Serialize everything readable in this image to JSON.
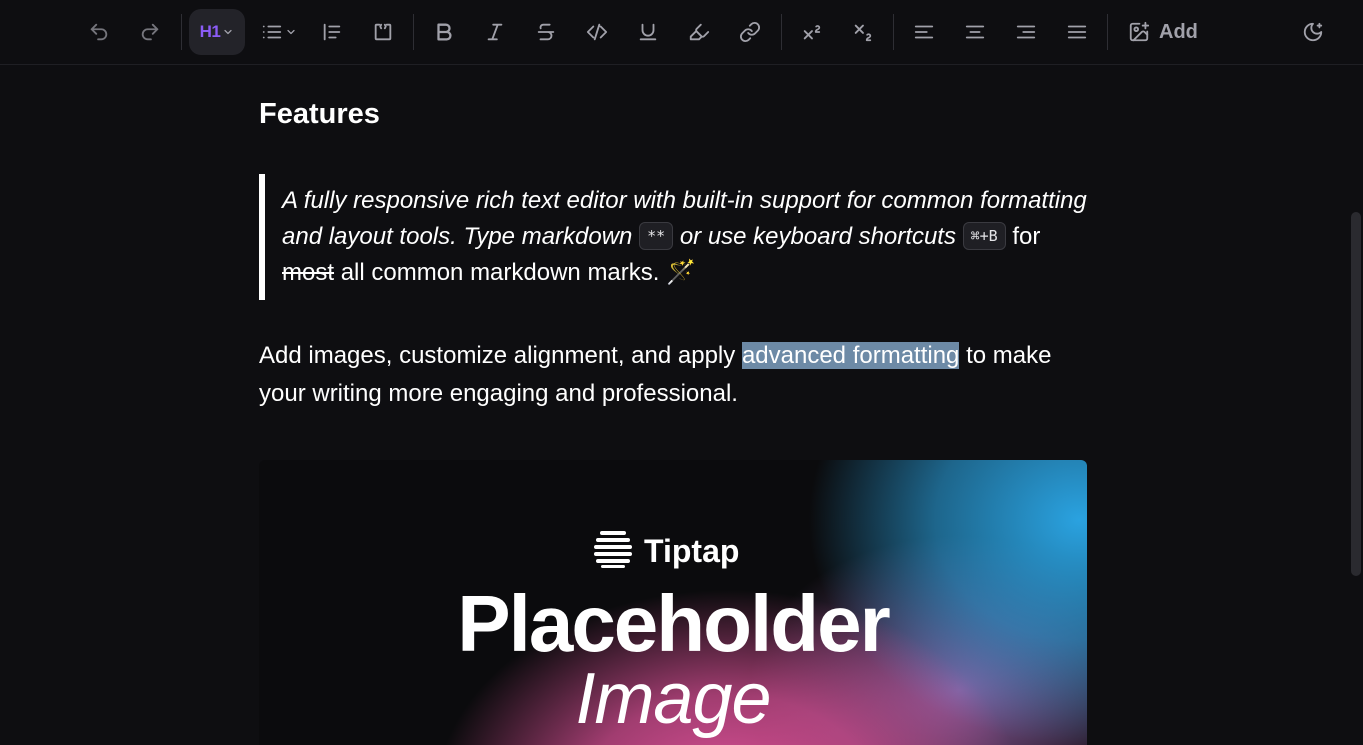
{
  "toolbar": {
    "buttons": [
      {
        "name": "undo",
        "icon": "undo-icon"
      },
      {
        "name": "redo",
        "icon": "redo-icon"
      },
      {
        "name": "heading",
        "icon": "heading-icon",
        "label": "H1",
        "active": true
      },
      {
        "name": "list",
        "icon": "list-icon"
      },
      {
        "name": "blockquote",
        "icon": "blockquote-icon"
      },
      {
        "name": "code-block",
        "icon": "code-block-icon"
      },
      {
        "name": "bold",
        "icon": "bold-icon"
      },
      {
        "name": "italic",
        "icon": "italic-icon"
      },
      {
        "name": "strike",
        "icon": "strikethrough-icon"
      },
      {
        "name": "code",
        "icon": "code-icon"
      },
      {
        "name": "underline",
        "icon": "underline-icon"
      },
      {
        "name": "highlight",
        "icon": "highlighter-icon"
      },
      {
        "name": "link",
        "icon": "link-icon"
      },
      {
        "name": "superscript",
        "icon": "superscript-icon"
      },
      {
        "name": "subscript",
        "icon": "subscript-icon"
      },
      {
        "name": "align-left",
        "icon": "align-left-icon"
      },
      {
        "name": "align-center",
        "icon": "align-center-icon"
      },
      {
        "name": "align-right",
        "icon": "align-right-icon"
      },
      {
        "name": "align-justify",
        "icon": "align-justify-icon"
      },
      {
        "name": "add-image",
        "icon": "image-plus-icon",
        "label": "Add"
      },
      {
        "name": "theme-toggle",
        "icon": "moon-icon"
      }
    ],
    "heading_label": "H1",
    "add_label": "Add"
  },
  "editor": {
    "heading": "Features",
    "quote": {
      "part1": "A fully responsive rich text editor with built-in support for common formatting and layout tools. Type markdown",
      "kbd1": "**",
      "part2": "or use keyboard shortcuts",
      "kbd2": "⌘+B",
      "part3": "for",
      "strike": "most",
      "part4": "all common markdown marks.",
      "emoji": "🪄"
    },
    "paragraph": {
      "before": "Add images, customize alignment, and apply",
      "highlight": "advanced formatting",
      "after": "to make your writing more engaging and professional."
    },
    "image": {
      "brand": "Tiptap",
      "title": "Placeholder",
      "subtitle": "Image"
    }
  },
  "colors": {
    "background": "#0e0e11",
    "accent": "#8b5cf6",
    "icon": "#a1a1aa",
    "selection": "#6d8aa6"
  }
}
